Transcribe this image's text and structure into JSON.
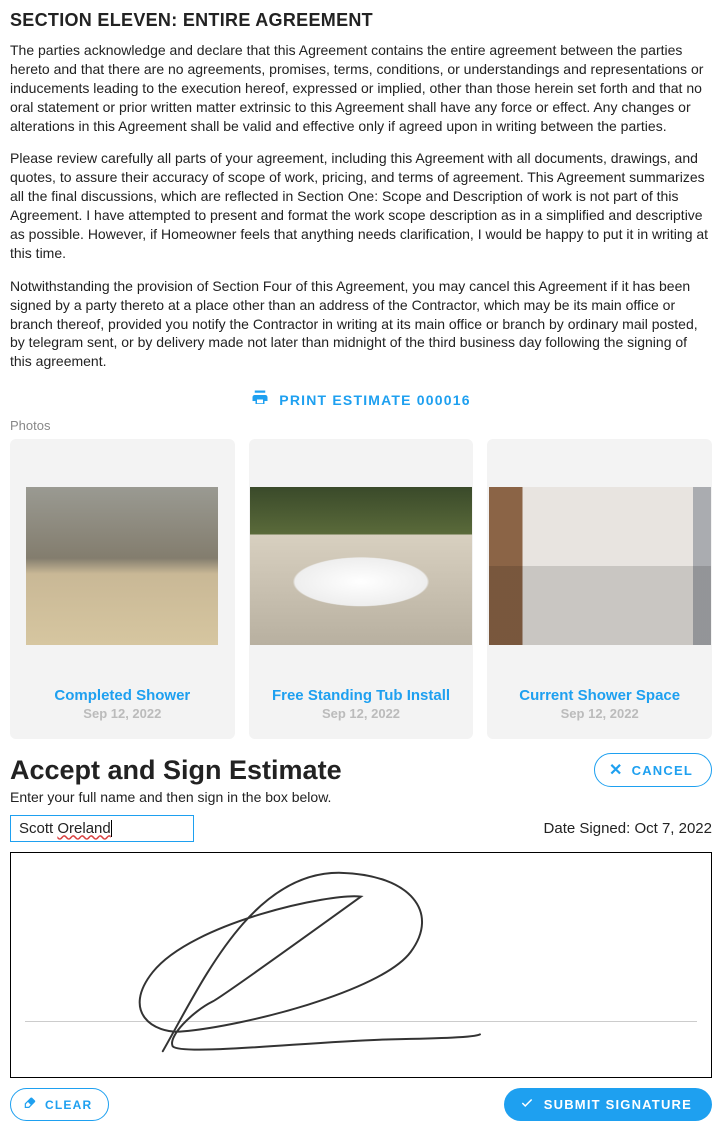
{
  "section": {
    "title": "SECTION ELEVEN:  ENTIRE AGREEMENT",
    "para1": "The parties acknowledge and declare that this Agreement contains the entire agreement between the parties hereto and that there are no agreements, promises, terms, conditions, or understandings and representations or inducements leading to the execution hereof, expressed or implied, other than those herein set forth and that no oral statement or prior written matter extrinsic to this Agreement shall have any force or effect.  Any changes or alterations in this Agreement shall be valid and effective only if agreed upon in writing between the parties.",
    "para2": "Please review carefully all parts of your agreement, including this Agreement with all documents, drawings, and quotes, to assure their accuracy of scope of work, pricing, and terms of agreement.  This Agreement summarizes all the final discussions, which are reflected in Section One: Scope and Description of work is not part of this Agreement.  I have attempted to present and format the work scope description as in a simplified and descriptive as possible. However, if Homeowner feels that anything needs clarification, I would be happy to put it in writing at this time.",
    "para3": "Notwithstanding the provision of Section Four of this Agreement, you may cancel this Agreement if it has been signed by a party thereto at a place other than an address of the Contractor, which may be its main office or branch thereof, provided you notify the Contractor in writing at its main office or branch by ordinary mail posted, by telegram sent, or by delivery made not later than midnight of the third business day following the signing of this agreement."
  },
  "print": {
    "label": "PRINT ESTIMATE 000016"
  },
  "photos": {
    "label": "Photos",
    "items": [
      {
        "title": "Completed Shower",
        "date": "Sep 12, 2022"
      },
      {
        "title": "Free Standing Tub Install",
        "date": "Sep 12, 2022"
      },
      {
        "title": "Current Shower Space",
        "date": "Sep 12, 2022"
      }
    ]
  },
  "accept": {
    "title": "Accept and Sign Estimate",
    "cancel_label": "CANCEL",
    "instruction": "Enter your full name and then sign in the box below.",
    "first_name": "Scott ",
    "last_name": "Oreland",
    "date_prefix": "Date Signed: ",
    "date_value": "Oct 7, 2022",
    "clear_label": "CLEAR",
    "submit_label": "SUBMIT SIGNATURE"
  }
}
